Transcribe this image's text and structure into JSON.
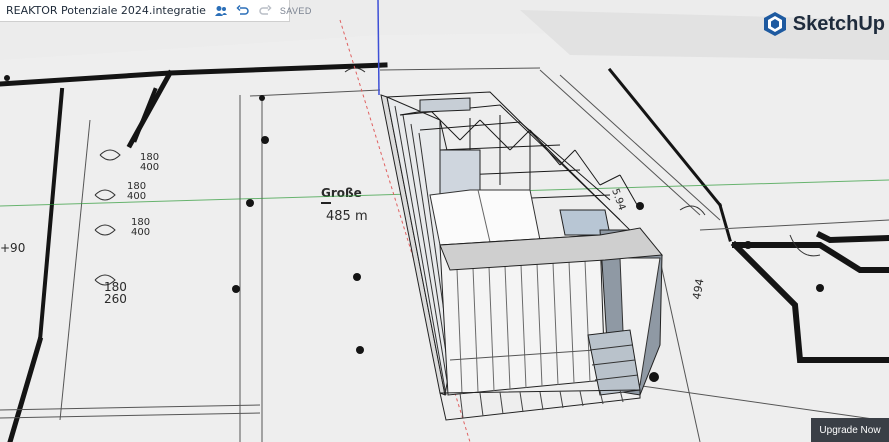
{
  "titlebar": {
    "title": "REAKTOR Potenziale 2024.integratie",
    "status": "SAVED"
  },
  "brand": {
    "name": "SketchUp",
    "color": "#1e2b3c"
  },
  "upgrade": {
    "label": "Upgrade Now"
  },
  "plan": {
    "dims": [
      {
        "top": "180",
        "bottom": "400"
      },
      {
        "top": "180",
        "bottom": "400"
      },
      {
        "top": "180",
        "bottom": "400"
      },
      {
        "top": "180",
        "bottom": "260"
      }
    ],
    "dim_prefix": "+90",
    "room_name": "Große",
    "room_area": "485 m",
    "dim_long_a": "5.94",
    "dim_long_b": "494"
  },
  "colors": {
    "floor": "#ececec",
    "wall": "#141414",
    "model_face": "#f4f4f4",
    "model_side": "#9aa4b0",
    "axis_red": "#e06060",
    "axis_green": "#2f9b39",
    "axis_blue": "#3d4fd6"
  }
}
